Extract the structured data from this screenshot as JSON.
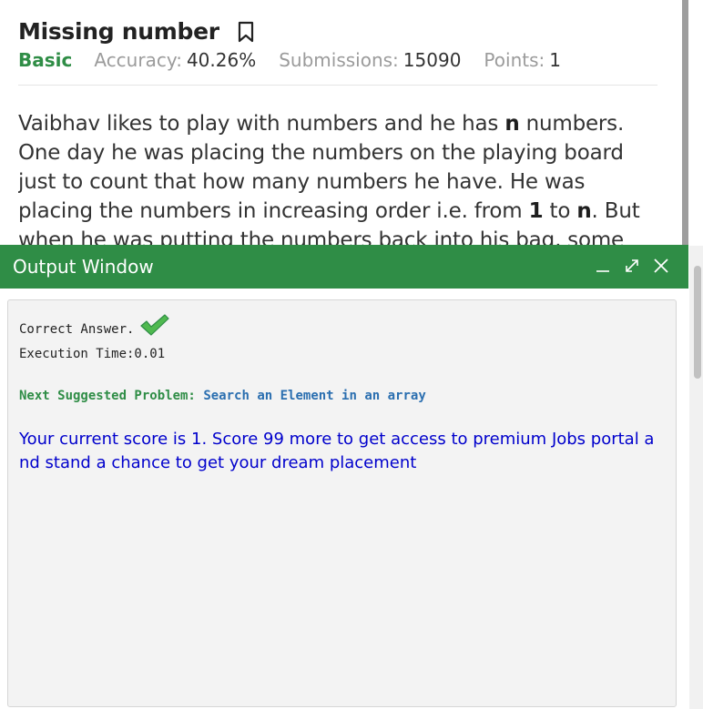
{
  "problem": {
    "title": "Missing number",
    "bookmark_icon": "bookmark-icon",
    "difficulty": "Basic",
    "accuracy_label": "Accuracy:",
    "accuracy_value": "40.26%",
    "submissions_label": "Submissions:",
    "submissions_value": "15090",
    "points_label": "Points:",
    "points_value": "1",
    "description": {
      "p1": "Vaibhav likes to play with numbers and he has ",
      "b1": "n",
      "p2": " numbers. One day he was placing the numbers on the playing board just to count that how many numbers he have. He was placing the numbers in increasing order i.e. from ",
      "b2": "1",
      "p3": " to ",
      "b3": "n",
      "p4": ". But when he was putting the numbers back into his bag, some numbers fell down"
    }
  },
  "output_window": {
    "title": "Output Window",
    "minimize_icon": "minimize-icon",
    "expand_icon": "expand-icon",
    "close_icon": "close-icon",
    "correct_text": "Correct Answer.",
    "execution_time": "Execution Time:0.01",
    "next_label": "Next Suggested Problem:",
    "next_problem": "Search an Element in an array",
    "score_message": "Your current score is 1. Score 99 more to get access to premium Jobs portal and stand a chance to get your dream placement"
  },
  "colors": {
    "brand_green": "#2f8d46",
    "link_blue": "#2b6fb0",
    "score_blue": "#0000cc"
  }
}
